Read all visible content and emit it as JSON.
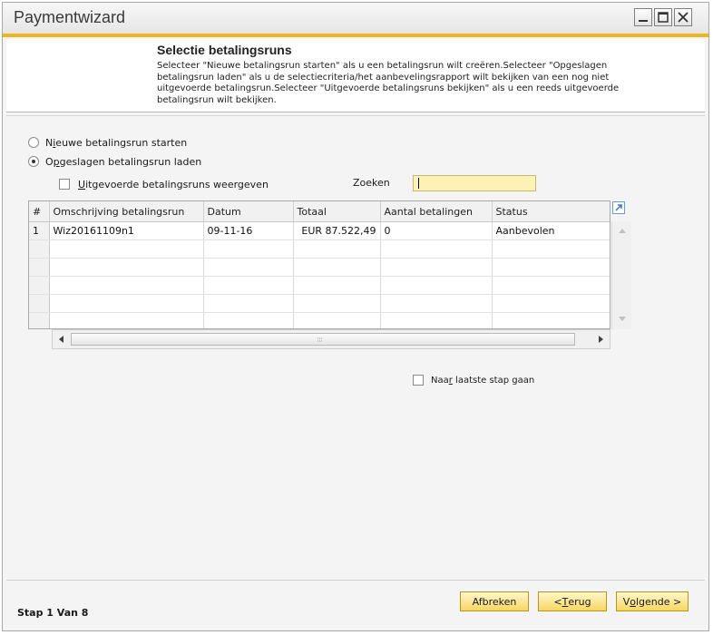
{
  "window": {
    "title": "Paymentwizard",
    "buttons": [
      "minimize-icon",
      "maximize-icon",
      "close-icon"
    ]
  },
  "header": {
    "title": "Selectie betalingsruns",
    "description": "Selecteer \"Nieuwe betalingsrun starten\" als u een betalingsrun wilt creëren.Selecteer \"Opgeslagen betalingsrun laden\" als u de selectiecriteria/het aanbevelingsrapport wilt bekijken van een nog niet uitgevoerde betalingsrun.Selecteer \"Uitgevoerde betalingsruns bekijken\" als u een reeds uitgevoerde betalingsrun wilt bekijken."
  },
  "options": {
    "new_run": {
      "pre": "N",
      "u": "i",
      "post": "euwe betalingsrun starten",
      "selected": false
    },
    "load_saved": {
      "pre": "O",
      "u": "p",
      "post": "geslagen betalingsrun laden",
      "selected": true
    },
    "show_executed": {
      "pre": "",
      "u": "U",
      "post": "itgevoerde betalingsruns weergeven",
      "checked": false
    }
  },
  "search": {
    "label": "Zoeken",
    "value": ""
  },
  "table": {
    "columns": [
      "#",
      "Omschrijving betalingsrun",
      "Datum",
      "Totaal",
      "Aantal betalingen",
      "Status"
    ],
    "rows": [
      [
        "1",
        "Wiz20161109n1",
        "09-11-16",
        "EUR 87.522,49",
        "0",
        "Aanbevolen"
      ]
    ],
    "empty_rows": 5
  },
  "goto_last": {
    "pre": "Naa",
    "u": "r",
    "post": " laatste stap gaan",
    "checked": false
  },
  "footer": {
    "step": "Stap 1 Van 8",
    "cancel": "Afbreken",
    "back": {
      "pre": "< ",
      "u": "T",
      "post": "erug"
    },
    "next": {
      "pre": "V",
      "u": "o",
      "post": "lgende >"
    }
  },
  "colors": {
    "accent": "#f0b51c",
    "button": "#f7d760",
    "search_bg": "#fdf2b3"
  }
}
